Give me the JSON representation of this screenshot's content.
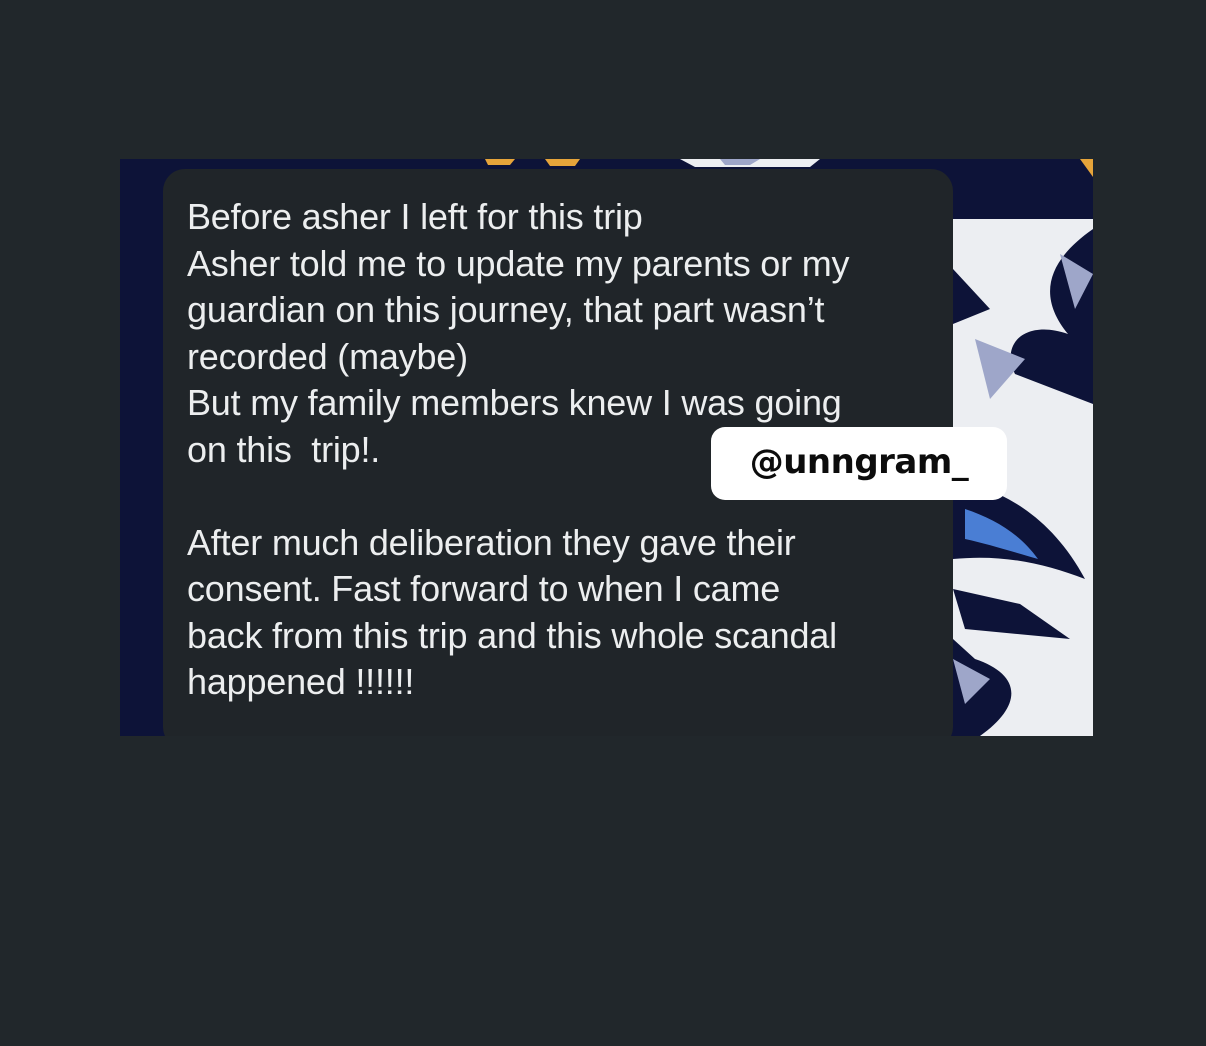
{
  "message": {
    "lines": [
      "Before asher I left for this trip",
      "Asher told me to update my parents or my",
      "guardian on this journey, that part wasn’t",
      "recorded (maybe)",
      "But my family members knew I was going",
      "on this  trip!.",
      "",
      "After much deliberation they gave their",
      "consent. Fast forward to when I came",
      "back from this trip and this whole scandal",
      "happened !!!!!!"
    ]
  },
  "watermark": {
    "handle": "@unngram_"
  },
  "colors": {
    "page_background": "#21272b",
    "bubble_background": "#202529",
    "wallpaper_dark": "#0d1338",
    "wallpaper_light": "#eceef2",
    "wallpaper_accent_blue": "#4a7ed4",
    "wallpaper_accent_orange": "#e6a43a",
    "text": "#eceeef"
  }
}
